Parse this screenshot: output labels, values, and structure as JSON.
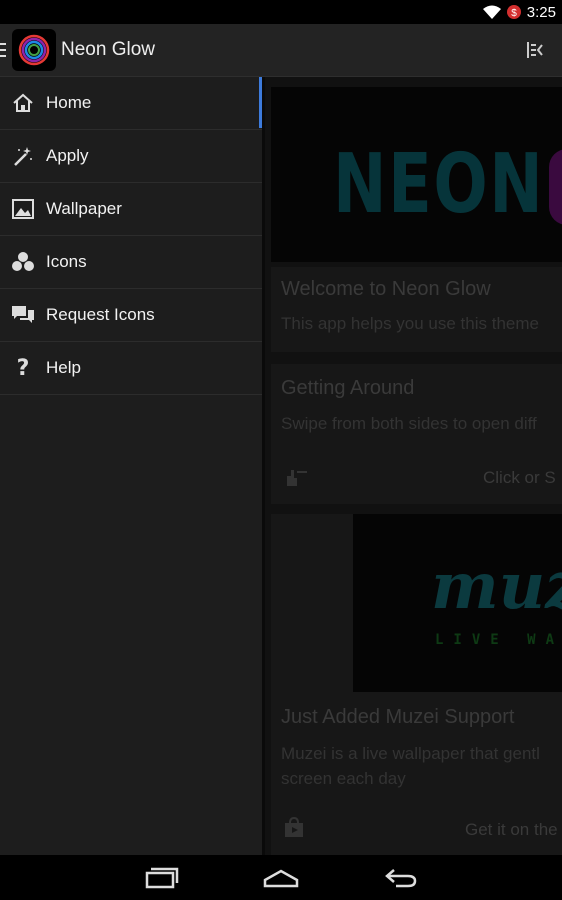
{
  "status_bar": {
    "time": "3:25",
    "icons": [
      "wifi-icon",
      "battery-icon"
    ]
  },
  "action_bar": {
    "title": "Neon Glow",
    "menu_icon": "hamburger-icon",
    "toggle_icon": "drawer-toggle-icon"
  },
  "drawer": {
    "active_color": "#3d7bdc",
    "items": [
      {
        "label": "Home",
        "icon": "home-icon"
      },
      {
        "label": "Apply",
        "icon": "magic-wand-icon"
      },
      {
        "label": "Wallpaper",
        "icon": "image-icon"
      },
      {
        "label": "Icons",
        "icon": "shapes-icon"
      },
      {
        "label": "Request Icons",
        "icon": "chat-icon"
      },
      {
        "label": "Help",
        "icon": "question-icon"
      }
    ]
  },
  "content": {
    "banner_text": "NEON",
    "welcome": {
      "title": "Welcome to Neon Glow",
      "body": "This app helps you use this theme"
    },
    "getting_around": {
      "title": "Getting Around",
      "body": "Swipe from both sides to open diff",
      "action": "Click or S"
    },
    "muzei": {
      "logo_text": "muz",
      "logo_subtext": "LIVE WAL",
      "title": "Just Added Muzei Support",
      "body_line1": "Muzei is a live wallpaper that gentl",
      "body_line2": "screen each day",
      "action": "Get it on the"
    }
  },
  "system_nav": {
    "buttons": [
      "recent-apps-icon",
      "home-button-icon",
      "back-icon"
    ]
  }
}
